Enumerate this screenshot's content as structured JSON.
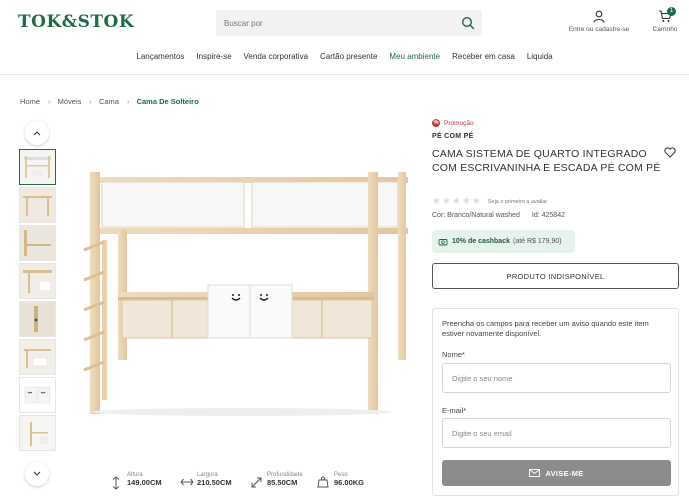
{
  "header": {
    "logo": "TOK&STOK",
    "search_placeholder": "Buscar por",
    "account_label": "Entre ou cadastre-se",
    "cart_label": "Carrinho",
    "cart_count": "1"
  },
  "nav": {
    "items": [
      "Lançamentos",
      "Inspire-se",
      "Venda corporativa",
      "Cartão presente",
      "Meu ambiente",
      "Receber em casa",
      "Liquida"
    ]
  },
  "breadcrumb": {
    "items": [
      "Home",
      "Móveis",
      "Cama"
    ],
    "current": "Cama De Solteiro"
  },
  "dimensions": [
    {
      "label": "Altura",
      "value": "149.00CM",
      "icon": "height-icon"
    },
    {
      "label": "Largura",
      "value": "210.50CM",
      "icon": "width-icon"
    },
    {
      "label": "Profundidade",
      "value": "85.50CM",
      "icon": "depth-icon"
    },
    {
      "label": "Peso",
      "value": "96.00KG",
      "icon": "weight-icon"
    }
  ],
  "product": {
    "promo": "Promoção",
    "brand": "PÉ COM PÉ",
    "title": "CAMA SISTEMA DE QUARTO INTEGRADO COM ESCRIVANINHA E ESCADA PÉ COM PÉ",
    "review_link": "Seja o primeiro a avaliar",
    "color": "Cor: Branco/Natural washed",
    "sku": "Id: 425842",
    "cashback": "10% de cashback",
    "cashback_extra": "(até R$ 179,90)",
    "unavailable_label": "PRODUTO INDISPONÍVEL"
  },
  "notify": {
    "text": "Preencha os campos para receber um aviso quando este item estiver novamente disponível.",
    "name_label": "Nome*",
    "name_placeholder": "Digite o seu nome",
    "email_label": "E-mail*",
    "email_placeholder": "Digite o seu email",
    "button_label": "AVISE-ME"
  },
  "colors": {
    "brand_green": "#1e6b4a",
    "promo_red": "#c23030",
    "button_gray": "#8c8c8c"
  }
}
